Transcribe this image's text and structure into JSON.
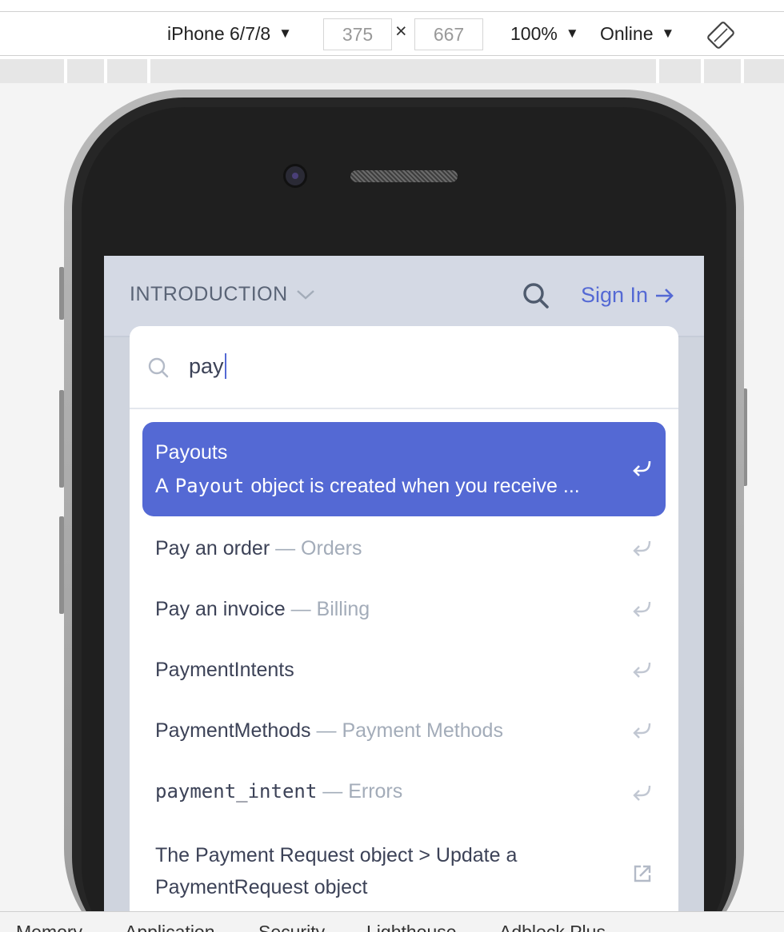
{
  "toolbar": {
    "device": "iPhone 6/7/8",
    "width": "375",
    "times": "×",
    "height": "667",
    "zoom": "100%",
    "network": "Online",
    "caret": "▼"
  },
  "app": {
    "section_label": "INTRODUCTION",
    "signin_label": "Sign In"
  },
  "search": {
    "query": "pay"
  },
  "results": {
    "active": {
      "title": "Payouts",
      "desc_prefix": "A",
      "desc_code": "Payout",
      "desc_rest": "object is created when you receive ..."
    },
    "items": [
      {
        "title": "Pay an order",
        "sep": "—",
        "category": "Orders"
      },
      {
        "title": "Pay an invoice",
        "sep": "—",
        "category": "Billing"
      },
      {
        "title": "PaymentIntents"
      },
      {
        "title": "PaymentMethods",
        "sep": "—",
        "category": "Payment Methods"
      },
      {
        "title": "payment_intent",
        "sep": "—",
        "category": "Errors"
      }
    ],
    "external": {
      "title": "The Payment Request object > Update a PaymentRequest object"
    }
  },
  "bottom_tabs": [
    "Memory",
    "Application",
    "Security",
    "Lighthouse",
    "Adblock Plus"
  ],
  "colors": {
    "accent": "#5469d4",
    "screen_bg": "#d4d9e4",
    "text": "#3c4257",
    "muted": "#a3acb9"
  },
  "icons": [
    "rotate-icon",
    "search-icon",
    "chevron-down-icon",
    "arrow-right-icon",
    "enter-icon",
    "external-link-icon"
  ]
}
